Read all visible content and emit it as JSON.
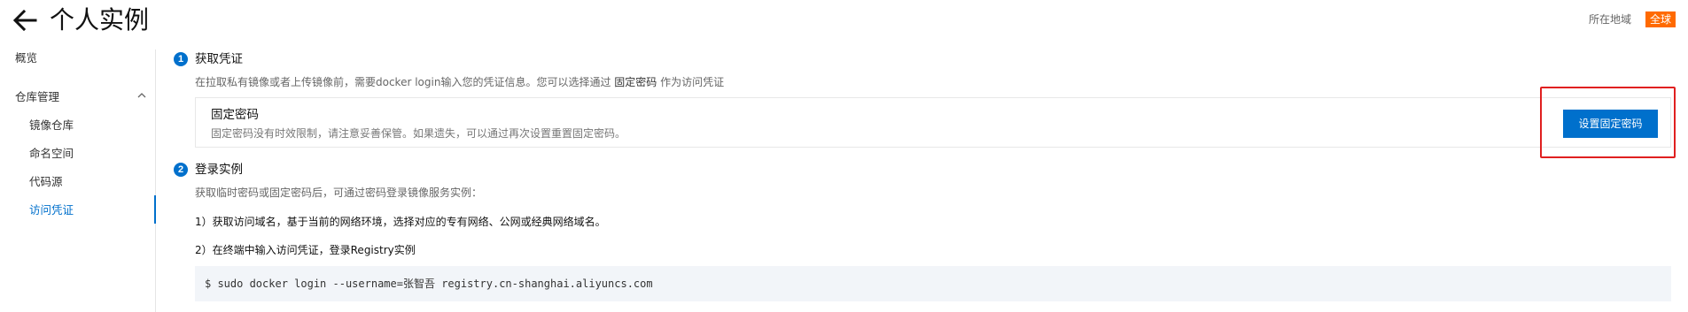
{
  "header": {
    "title": "个人实例",
    "back_icon": "arrow-left-icon",
    "region_label": "所在地域",
    "region_value": "全球",
    "region_badge_color": "#ff6a00"
  },
  "sidebar": {
    "items": [
      {
        "label": "概览"
      },
      {
        "label": "仓库管理",
        "expanded": true,
        "icon": "chevron-up-icon"
      },
      {
        "label": "镜像仓库"
      },
      {
        "label": "命名空间"
      },
      {
        "label": "代码源"
      },
      {
        "label": "访问凭证",
        "active": true
      }
    ],
    "active_color": "#0070cc"
  },
  "steps": [
    {
      "number": "1",
      "title": "获取凭证",
      "desc_prefix": "在拉取私有镜像或者上传镜像前，需要docker login输入您的凭证信息。您可以选择通过",
      "desc_highlight": "固定密码",
      "desc_suffix": "作为访问凭证",
      "credential": {
        "title": "固定密码",
        "desc": "固定密码没有时效限制，请注意妥善保管。如果遗失，可以通过再次设置重置固定密码。",
        "button_label": "设置固定密码"
      }
    },
    {
      "number": "2",
      "title": "登录实例",
      "desc": "获取临时密码或固定密码后，可通过密码登录镜像服务实例：",
      "lines": [
        "1）获取访问域名，基于当前的网络环境，选择对应的专有网络、公网或经典网络域名。",
        "2）在终端中输入访问凭证，登录Registry实例"
      ],
      "command": "$ sudo docker login --username=张智吾 registry.cn-shanghai.aliyuncs.com"
    }
  ],
  "colors": {
    "primary": "#0070cc",
    "highlight_border": "#e02020",
    "code_bg": "#f2f5f9"
  }
}
